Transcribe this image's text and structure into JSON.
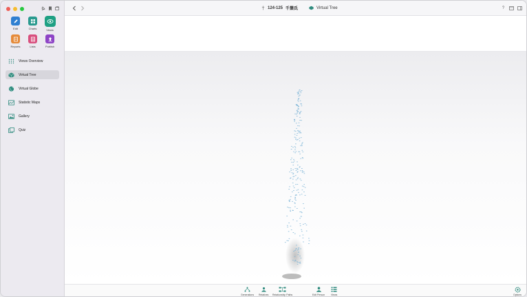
{
  "window": {
    "title_prefix": "124-125",
    "title_main": "千葉氏",
    "view_title": "Virtual Tree"
  },
  "apps": [
    {
      "label": "Edit",
      "icon": "pencil-icon",
      "color": "#2f7fd1"
    },
    {
      "label": "Charts",
      "icon": "charts-grid-icon",
      "color": "#2a9a8f"
    },
    {
      "label": "Views",
      "icon": "eye-icon",
      "color": "#1fa084"
    },
    {
      "label": "Reports",
      "icon": "reports-icon",
      "color": "#e58a3a"
    },
    {
      "label": "Lists",
      "icon": "lists-icon",
      "color": "#d84f7e"
    },
    {
      "label": "Publish",
      "icon": "publish-icon",
      "color": "#8e44c6"
    }
  ],
  "nav": [
    {
      "label": "Views Overview",
      "icon": "grid-dots-icon"
    },
    {
      "label": "Virtual Tree",
      "icon": "cube-icon",
      "active": true
    },
    {
      "label": "Virtual Globe",
      "icon": "globe-icon"
    },
    {
      "label": "Statistic Maps",
      "icon": "map-icon"
    },
    {
      "label": "Gallery",
      "icon": "gallery-icon"
    },
    {
      "label": "Quiz",
      "icon": "quiz-icon"
    }
  ],
  "bottom": [
    {
      "label": "Generations",
      "icon": "generations-icon"
    },
    {
      "label": "Relatives",
      "icon": "relatives-icon"
    },
    {
      "label": "Relationship Paths",
      "icon": "relationship-paths-icon"
    },
    {
      "label": "Edit Person",
      "icon": "edit-person-icon"
    },
    {
      "label": "Views",
      "icon": "views-list-icon"
    },
    {
      "label": "Options",
      "icon": "options-gear-icon"
    }
  ],
  "colors": {
    "accent": "#2f8b7e",
    "tree_node": "#7ab3d6"
  }
}
